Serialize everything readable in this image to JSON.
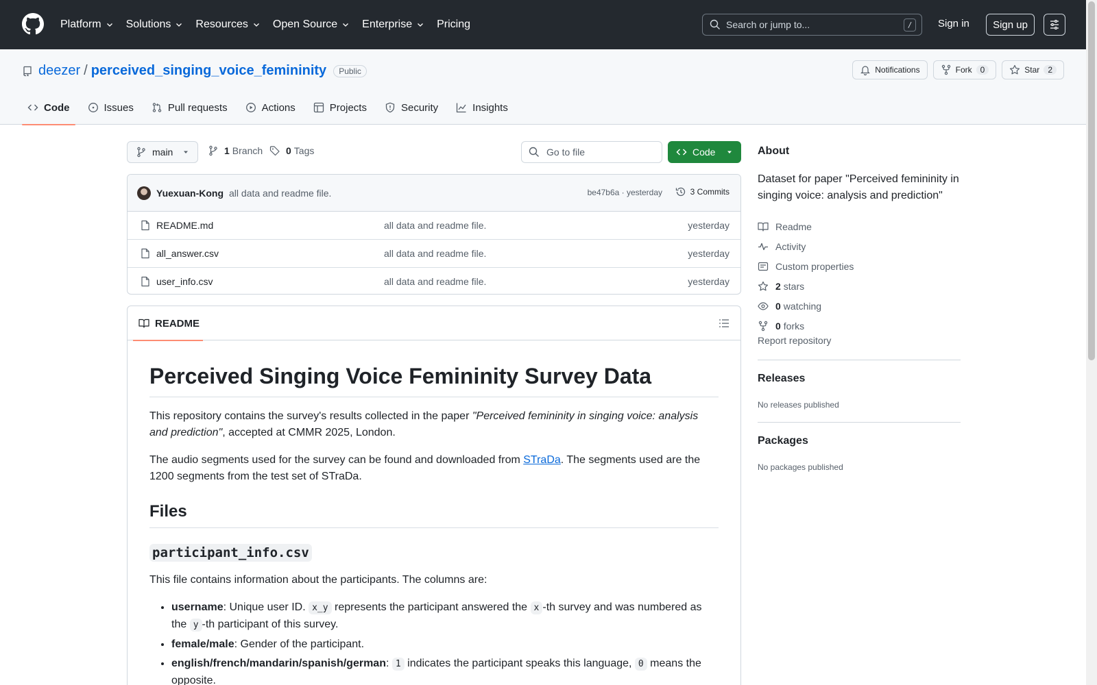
{
  "topnav": {
    "items": [
      {
        "label": "Platform",
        "dropdown": true
      },
      {
        "label": "Solutions",
        "dropdown": true
      },
      {
        "label": "Resources",
        "dropdown": true
      },
      {
        "label": "Open Source",
        "dropdown": true
      },
      {
        "label": "Enterprise",
        "dropdown": true
      },
      {
        "label": "Pricing",
        "dropdown": false
      }
    ],
    "search_placeholder": "Search or jump to...",
    "search_key": "/",
    "signin": "Sign in",
    "signup": "Sign up"
  },
  "repo": {
    "owner": "deezer",
    "separator": "/",
    "name": "perceived_singing_voice_femininity",
    "visibility": "Public",
    "notifications_label": "Notifications",
    "fork_label": "Fork",
    "fork_count": "0",
    "star_label": "Star",
    "star_count": "2"
  },
  "tabs": [
    {
      "label": "Code",
      "icon": "code-icon",
      "active": true
    },
    {
      "label": "Issues",
      "icon": "issue-icon",
      "active": false
    },
    {
      "label": "Pull requests",
      "icon": "pull-request-icon",
      "active": false
    },
    {
      "label": "Actions",
      "icon": "play-icon",
      "active": false
    },
    {
      "label": "Projects",
      "icon": "table-icon",
      "active": false
    },
    {
      "label": "Security",
      "icon": "shield-icon",
      "active": false
    },
    {
      "label": "Insights",
      "icon": "graph-icon",
      "active": false
    }
  ],
  "toolbar": {
    "branch": "main",
    "branch_count": "1",
    "branch_label": "Branch",
    "tag_count": "0",
    "tag_label": "Tags",
    "goto_placeholder": "Go to file",
    "code_label": "Code"
  },
  "commit": {
    "author": "Yuexuan-Kong",
    "message": "all data and readme file.",
    "meta": "be47b6a · yesterday",
    "commits_label": "3 Commits"
  },
  "files": [
    {
      "name": "README.md",
      "message": "all data and readme file.",
      "date": "yesterday"
    },
    {
      "name": "all_answer.csv",
      "message": "all data and readme file.",
      "date": "yesterday"
    },
    {
      "name": "user_info.csv",
      "message": "all data and readme file.",
      "date": "yesterday"
    }
  ],
  "readme": {
    "tab": "README",
    "h1": "Perceived Singing Voice Femininity Survey Data",
    "p1_a": "This repository contains the survey's results collected in the paper ",
    "p1_em": "\"Perceived femininity in singing voice: analysis and prediction\"",
    "p1_b": ", accepted at CMMR 2025, London.",
    "p2_a": "The audio segments used for the survey can be found and downloaded from ",
    "p2_link": "STraDa",
    "p2_b": ". The segments used are the 1200 segments from the test set of STraDa.",
    "h2": "Files",
    "h3": "participant_info.csv",
    "p3": "This file contains information about the participants. The columns are:",
    "li1_b": "username",
    "li1_a": ": Unique user ID. ",
    "li1_c1": "x_y",
    "li1_t2": " represents the participant answered the ",
    "li1_c2": "x",
    "li1_t3": "-th survey and was numbered as the ",
    "li1_c3": "y",
    "li1_t4": "-th participant of this survey.",
    "li2_b": "female/male",
    "li2_a": ": Gender of the participant.",
    "li3_b": "english/french/mandarin/spanish/german",
    "li3_a": ": ",
    "li3_c1": "1",
    "li3_t2": " indicates the participant speaks this language, ",
    "li3_c2": "0",
    "li3_t3": " means the opposite."
  },
  "about": {
    "title": "About",
    "description": "Dataset for paper \"Perceived femininity in singing voice: analysis and prediction\"",
    "readme": "Readme",
    "activity": "Activity",
    "custom_properties": "Custom properties",
    "stars_count": "2",
    "stars_label": "stars",
    "watching_count": "0",
    "watching_label": "watching",
    "forks_count": "0",
    "forks_label": "forks",
    "report": "Report repository"
  },
  "releases": {
    "title": "Releases",
    "text": "No releases published"
  },
  "packages": {
    "title": "Packages",
    "text": "No packages published"
  }
}
